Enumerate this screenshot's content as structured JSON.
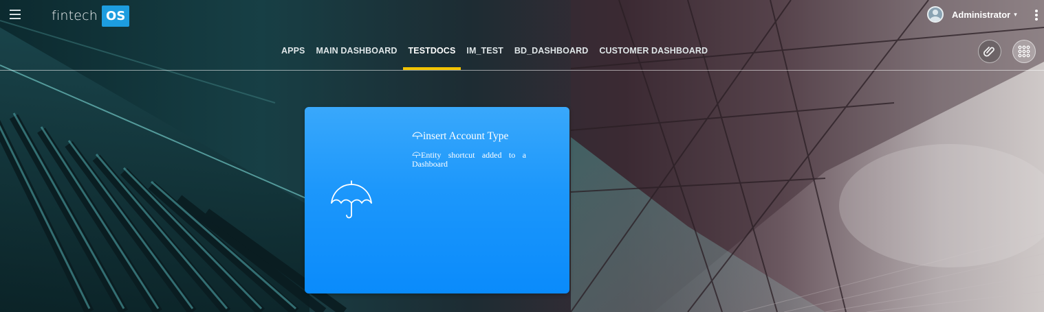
{
  "app": {
    "logo_text": "fintech",
    "logo_badge": "OS",
    "brand_color": "#1d9de0"
  },
  "user": {
    "name": "Administrator",
    "caret": "▾"
  },
  "tabs": [
    {
      "label": "APPS",
      "active": false
    },
    {
      "label": "MAIN DASHBOARD",
      "active": false
    },
    {
      "label": "TESTDOCS",
      "active": true
    },
    {
      "label": "IM_TEST",
      "active": false
    },
    {
      "label": "BD_DASHBOARD",
      "active": false
    },
    {
      "label": "CUSTOMER DASHBOARD",
      "active": false
    }
  ],
  "active_tab_indicator_color": "#f2c300",
  "actions": {
    "attach_icon": "paperclip-icon",
    "apps_icon": "grid-dots-icon"
  },
  "card": {
    "icon": "umbrella-icon",
    "title": "insert Account Type",
    "description": "Entity shortcut added to a Dashboard",
    "color": "#1c97fb"
  }
}
